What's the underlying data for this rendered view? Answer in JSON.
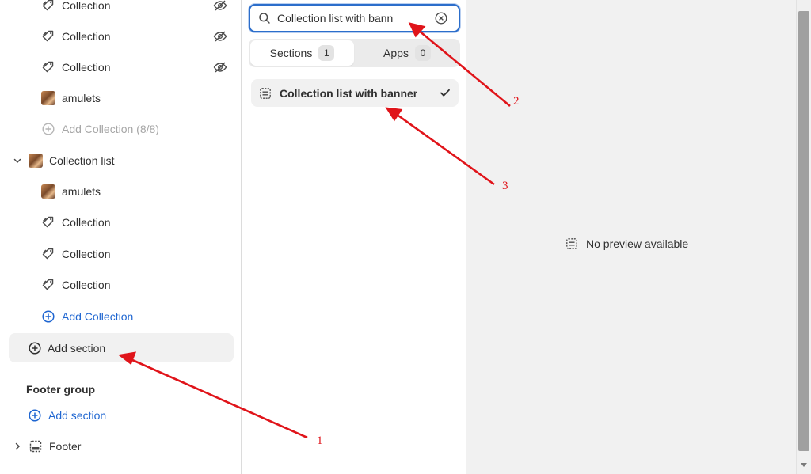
{
  "sidebar": {
    "top_items": [
      {
        "label": "Collection",
        "icon": "collection-tag-icon",
        "hidden": true
      },
      {
        "label": "Collection",
        "icon": "collection-tag-icon",
        "hidden": true
      },
      {
        "label": "Collection",
        "icon": "collection-tag-icon",
        "hidden": true
      },
      {
        "label": "amulets",
        "icon": "collection-image-thumbnail",
        "hidden": false
      }
    ],
    "add_collection_disabled": "Add Collection (8/8)",
    "collection_list": {
      "label": "Collection list",
      "items": [
        {
          "label": "amulets"
        },
        {
          "label": "Collection"
        },
        {
          "label": "Collection"
        },
        {
          "label": "Collection"
        }
      ],
      "add_collection": "Add Collection"
    },
    "add_section": "Add section",
    "footer_group": {
      "title": "Footer group",
      "add_section": "Add section",
      "footer": "Footer"
    }
  },
  "picker": {
    "search_value": "Collection list with bann",
    "tabs": [
      {
        "label": "Sections",
        "count": "1"
      },
      {
        "label": "Apps",
        "count": "0"
      }
    ],
    "result": "Collection list with banner"
  },
  "preview": {
    "message": "No preview available"
  },
  "annotations": [
    {
      "label": "1"
    },
    {
      "label": "2"
    },
    {
      "label": "3"
    }
  ],
  "colors": {
    "link": "#1f66d1",
    "focus_ring": "#2c6ecb",
    "annotation": "#e0141a",
    "selected_bg": "#f1f1f1"
  }
}
